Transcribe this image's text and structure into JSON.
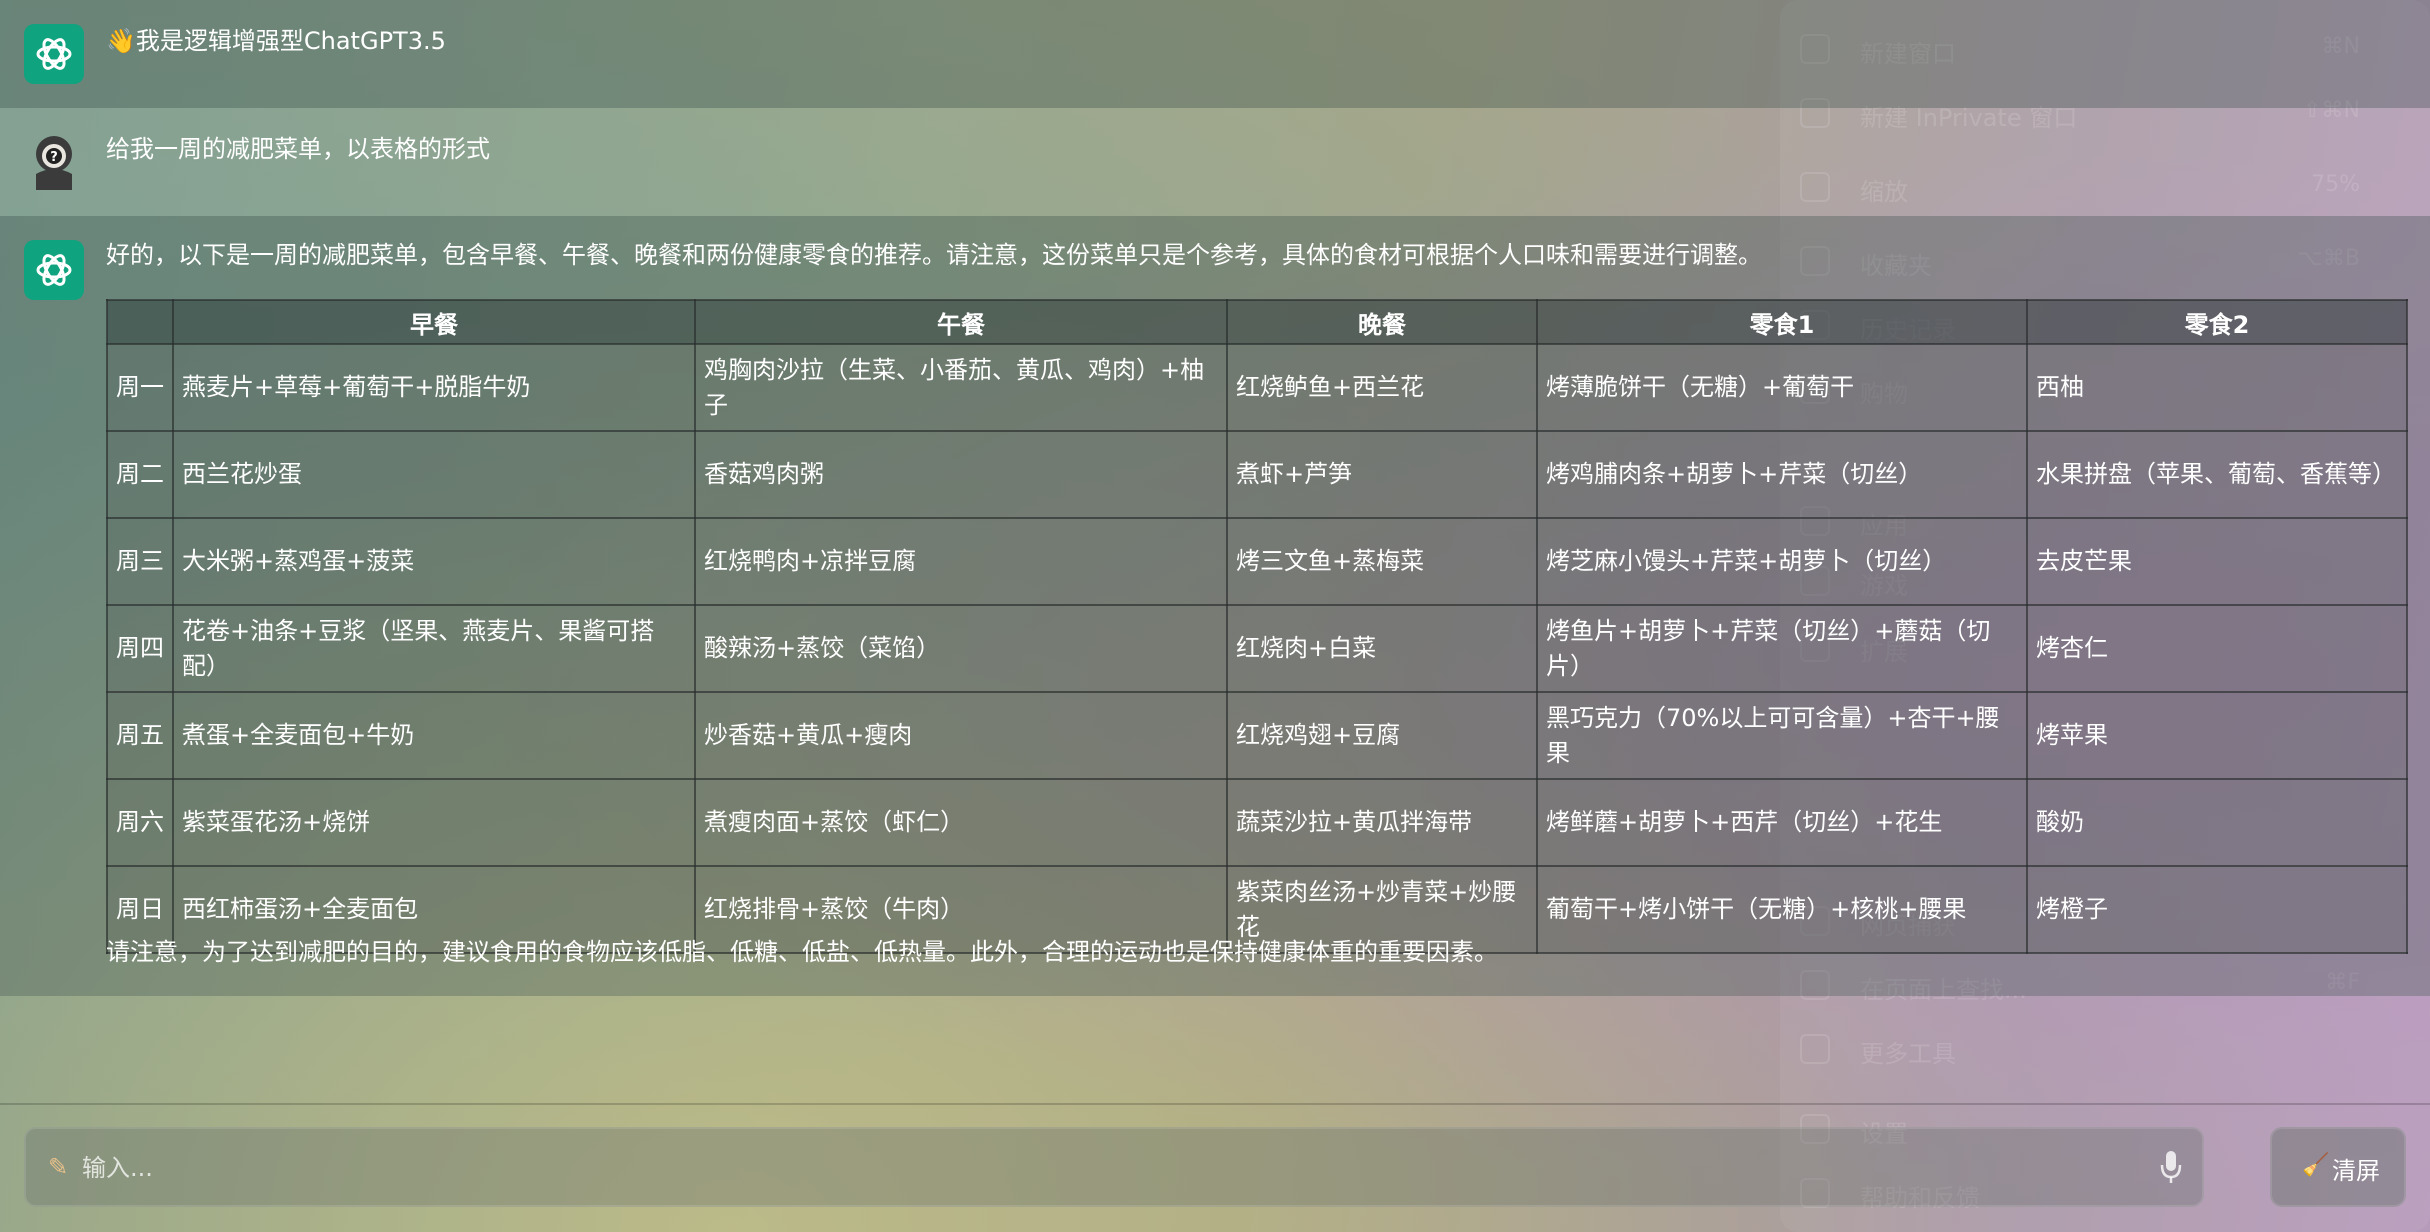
{
  "app": {
    "intro_text": "👋我是逻辑增强型ChatGPT3.5"
  },
  "background_menu": {
    "items": [
      {
        "label": "新建窗口",
        "shortcut": "⌘N"
      },
      {
        "label": "新建 InPrivate 窗口",
        "shortcut": "⇧⌘N"
      },
      {
        "label": "缩放",
        "shortcut": "75%"
      },
      {
        "label": "收藏夹",
        "shortcut": "⌥⌘B"
      },
      {
        "label": "历史记录",
        "shortcut": ""
      },
      {
        "label": "购物",
        "shortcut": ""
      },
      {
        "label": "应用",
        "shortcut": ""
      },
      {
        "label": "游戏",
        "shortcut": ""
      },
      {
        "label": "扩展",
        "shortcut": ""
      },
      {
        "label": "网页捕获",
        "shortcut": ""
      },
      {
        "label": "在页面上查找...",
        "shortcut": "⌘F"
      },
      {
        "label": "更多工具",
        "shortcut": ""
      },
      {
        "label": "设置",
        "shortcut": ""
      },
      {
        "label": "帮助和反馈",
        "shortcut": ""
      }
    ]
  },
  "messages": {
    "user_prompt": "给我一周的减肥菜单，以表格的形式",
    "reply_intro": "好的，以下是一周的减肥菜单，包含早餐、午餐、晚餐和两份健康零食的推荐。请注意，这份菜单只是个参考，具体的食材可根据个人口味和需要进行调整。",
    "reply_outro": "请注意，为了达到减肥的目的，建议食用的食物应该低脂、低糖、低盐、低热量。此外，合理的运动也是保持健康体重的重要因素。"
  },
  "table": {
    "headers": [
      "",
      "早餐",
      "午餐",
      "晚餐",
      "零食1",
      "零食2"
    ],
    "rows": [
      [
        "周一",
        "燕麦片+草莓+葡萄干+脱脂牛奶",
        "鸡胸肉沙拉（生菜、小番茄、黄瓜、鸡肉）+柚子",
        "红烧鲈鱼+西兰花",
        "烤薄脆饼干（无糖）+葡萄干",
        "西柚"
      ],
      [
        "周二",
        "西兰花炒蛋",
        "香菇鸡肉粥",
        "煮虾+芦笋",
        "烤鸡脯肉条+胡萝卜+芹菜（切丝）",
        "水果拼盘（苹果、葡萄、香蕉等）"
      ],
      [
        "周三",
        "大米粥+蒸鸡蛋+菠菜",
        "红烧鸭肉+凉拌豆腐",
        "烤三文鱼+蒸梅菜",
        "烤芝麻小馒头+芹菜+胡萝卜（切丝）",
        "去皮芒果"
      ],
      [
        "周四",
        "花卷+油条+豆浆（坚果、燕麦片、果酱可搭配）",
        "酸辣汤+蒸饺（菜馅）",
        "红烧肉+白菜",
        "烤鱼片+胡萝卜+芹菜（切丝）+蘑菇（切片）",
        "烤杏仁"
      ],
      [
        "周五",
        "煮蛋+全麦面包+牛奶",
        "炒香菇+黄瓜+瘦肉",
        "红烧鸡翅+豆腐",
        "黑巧克力（70%以上可可含量）+杏干+腰果",
        "烤苹果"
      ],
      [
        "周六",
        "紫菜蛋花汤+烧饼",
        "煮瘦肉面+蒸饺（虾仁）",
        "蔬菜沙拉+黄瓜拌海带",
        "烤鲜蘑+胡萝卜+西芹（切丝）+花生",
        "酸奶"
      ],
      [
        "周日",
        "西红柿蛋汤+全麦面包",
        "红烧排骨+蒸饺（牛肉）",
        "紫菜肉丝汤+炒青菜+炒腰花",
        "葡萄干+烤小饼干（无糖）+核桃+腰果",
        "烤橙子"
      ]
    ]
  },
  "composer": {
    "placeholder": "输入...",
    "clear_label": "清屏"
  }
}
